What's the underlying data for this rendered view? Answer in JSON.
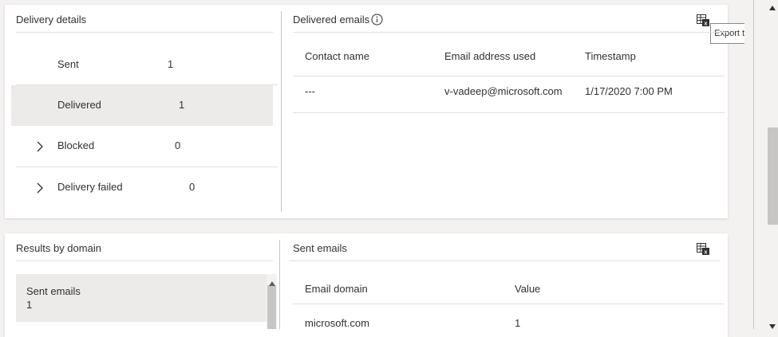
{
  "delivery_details": {
    "title": "Delivery details",
    "rows": [
      {
        "label": "Sent",
        "value": "1"
      },
      {
        "label": "Delivered",
        "value": "1"
      },
      {
        "label": "Blocked",
        "value": "0"
      },
      {
        "label": "Delivery failed",
        "value": "0"
      }
    ]
  },
  "delivered_emails": {
    "title": "Delivered emails",
    "columns": [
      "Contact name",
      "Email address used",
      "Timestamp"
    ],
    "rows": [
      [
        "---",
        "v-vadeep@microsoft.com",
        "1/17/2020 7:00 PM"
      ]
    ],
    "export_tooltip": "Export to CSV"
  },
  "results_by_domain": {
    "title": "Results by domain",
    "item_label": "Sent emails",
    "item_value": "1"
  },
  "sent_emails": {
    "title": "Sent emails",
    "columns": [
      "Email domain",
      "Value"
    ],
    "rows": [
      [
        "microsoft.com",
        "1"
      ]
    ]
  },
  "icons": {
    "export": "excel-export-icon",
    "info": "info-icon",
    "chevron": "chevron-right-icon"
  }
}
